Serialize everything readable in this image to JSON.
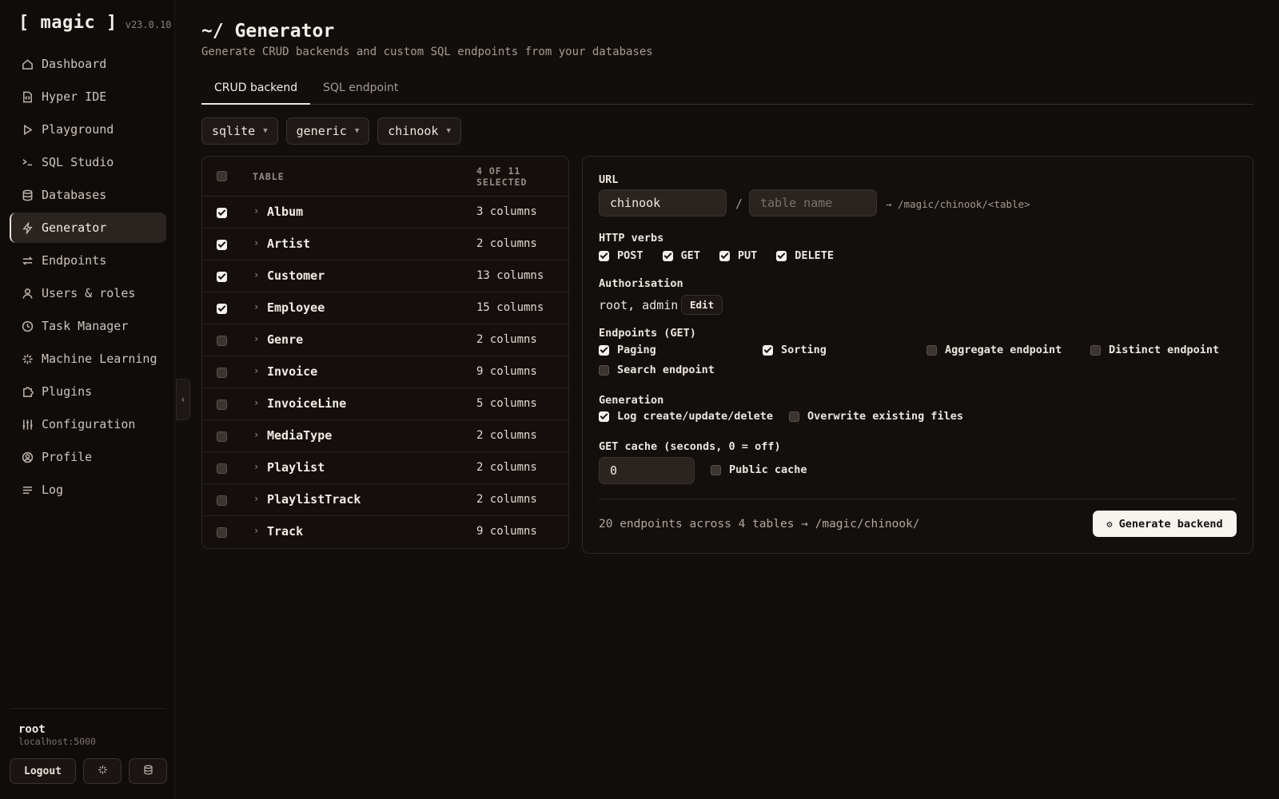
{
  "sidebar": {
    "brand": "[ magic ]",
    "version": "v23.0.10",
    "items": [
      {
        "label": "Dashboard",
        "icon": "home-icon"
      },
      {
        "label": "Hyper IDE",
        "icon": "file-code-icon"
      },
      {
        "label": "Playground",
        "icon": "play-icon"
      },
      {
        "label": "SQL Studio",
        "icon": "terminal-icon"
      },
      {
        "label": "Databases",
        "icon": "database-icon"
      },
      {
        "label": "Generator",
        "icon": "bolt-icon",
        "active": true
      },
      {
        "label": "Endpoints",
        "icon": "arrows-icon"
      },
      {
        "label": "Users & roles",
        "icon": "user-icon"
      },
      {
        "label": "Task Manager",
        "icon": "clock-icon"
      },
      {
        "label": "Machine Learning",
        "icon": "sparkle-icon"
      },
      {
        "label": "Plugins",
        "icon": "puzzle-icon"
      },
      {
        "label": "Configuration",
        "icon": "sliders-icon"
      },
      {
        "label": "Profile",
        "icon": "profile-icon"
      },
      {
        "label": "Log",
        "icon": "lines-icon"
      }
    ],
    "user": "root",
    "host": "localhost:5000",
    "logout_label": "Logout"
  },
  "header": {
    "title": "~/ Generator",
    "subtitle": "Generate CRUD backends and custom SQL endpoints from your databases"
  },
  "tabs": [
    "CRUD backend",
    "SQL endpoint"
  ],
  "selects": [
    "sqlite",
    "generic",
    "chinook"
  ],
  "table": {
    "col_table": "TABLE",
    "col_selected": "4 OF 11 SELECTED",
    "rows": [
      {
        "name": "Album",
        "columns": "3 columns",
        "checked": true
      },
      {
        "name": "Artist",
        "columns": "2 columns",
        "checked": true
      },
      {
        "name": "Customer",
        "columns": "13 columns",
        "checked": true
      },
      {
        "name": "Employee",
        "columns": "15 columns",
        "checked": true
      },
      {
        "name": "Genre",
        "columns": "2 columns",
        "checked": false
      },
      {
        "name": "Invoice",
        "columns": "9 columns",
        "checked": false
      },
      {
        "name": "InvoiceLine",
        "columns": "5 columns",
        "checked": false
      },
      {
        "name": "MediaType",
        "columns": "2 columns",
        "checked": false
      },
      {
        "name": "Playlist",
        "columns": "2 columns",
        "checked": false
      },
      {
        "name": "PlaylistTrack",
        "columns": "2 columns",
        "checked": false
      },
      {
        "name": "Track",
        "columns": "9 columns",
        "checked": false
      }
    ]
  },
  "config": {
    "url_label": "URL",
    "url_value": "chinook",
    "slash": "/",
    "table_placeholder": "table name",
    "url_preview": "→ /magic/chinook/<table>",
    "verbs_label": "HTTP verbs",
    "verbs": [
      "POST",
      "GET",
      "PUT",
      "DELETE"
    ],
    "auth_label": "Authorisation",
    "auth_value": "root, admin",
    "edit_label": "Edit",
    "endpoints_label": "Endpoints (GET)",
    "endpoints": {
      "paging": "Paging",
      "sorting": "Sorting",
      "aggregate": "Aggregate endpoint",
      "distinct": "Distinct endpoint",
      "search": "Search endpoint"
    },
    "generation_label": "Generation",
    "log": "Log create/update/delete",
    "overwrite": "Overwrite existing files",
    "cache_label": "GET cache (seconds, 0 = off)",
    "cache_value": "0",
    "public_cache": "Public cache",
    "summary": "20 endpoints across 4 tables → /magic/chinook/",
    "generate_label": "Generate backend",
    "generate_icon": "⚙"
  }
}
